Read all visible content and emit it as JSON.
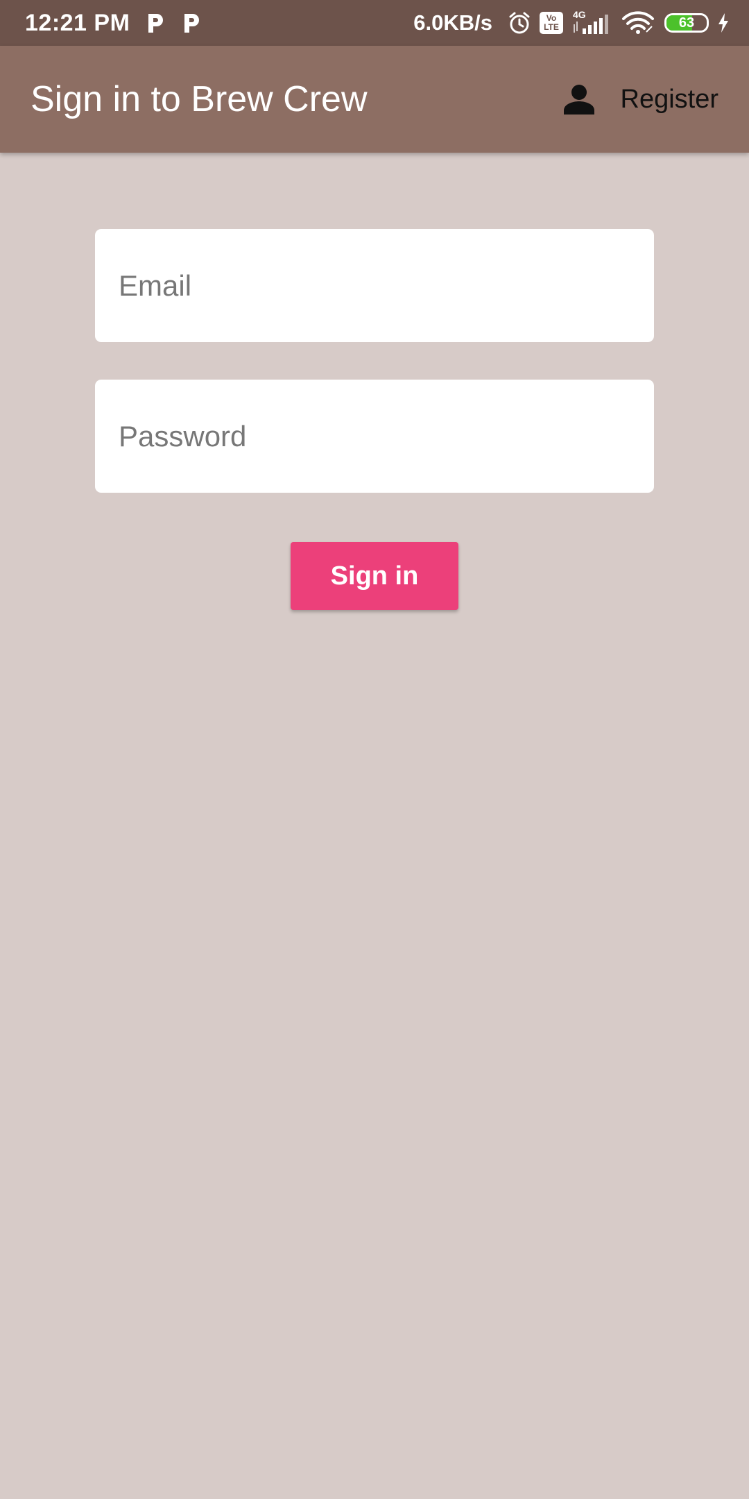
{
  "status_bar": {
    "time": "12:21 PM",
    "net_speed": "6.0KB/s",
    "network_type": "4G",
    "volte_top": "Vo",
    "volte_bottom": "LTE",
    "battery_level": "63",
    "battery_percent": 63,
    "icons": [
      "p-notification-icon",
      "p-notification-icon",
      "alarm-icon",
      "volte-icon",
      "signal-icon",
      "wifi-icon",
      "battery-icon",
      "charging-icon"
    ]
  },
  "app_bar": {
    "title": "Sign in to Brew Crew",
    "register_label": "Register",
    "register_icon": "person-icon"
  },
  "form": {
    "email": {
      "placeholder": "Email",
      "value": ""
    },
    "password": {
      "placeholder": "Password",
      "value": ""
    },
    "submit_label": "Sign in"
  },
  "colors": {
    "status_bar": "#6d534b",
    "app_bar": "#8d6e63",
    "background": "#d7cbc8",
    "accent": "#ec407a",
    "battery_fill": "#4cc12b"
  }
}
